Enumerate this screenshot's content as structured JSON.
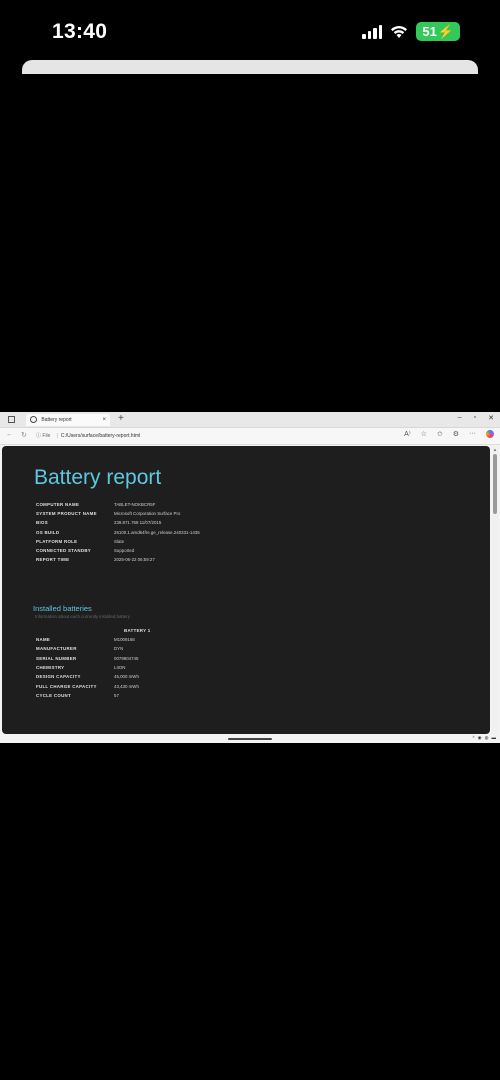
{
  "status_bar": {
    "time": "13:40",
    "battery_percent": "51",
    "battery_color": "#34c759"
  },
  "browser": {
    "tab_title": "Battery report",
    "tab_close": "×",
    "new_tab": "+",
    "window_controls": [
      "–",
      "▫",
      "✕"
    ],
    "url_info": "ⓘ File",
    "url_path": "C:/Users/surface/battery-report.html"
  },
  "report": {
    "title": "Battery report",
    "title_color": "#5ec8e0",
    "system_info": [
      {
        "key": "COMPUTER NAME",
        "value": "TABLET-NOKBCR5F"
      },
      {
        "key": "SYSTEM PRODUCT NAME",
        "value": "Microsoft Corporation Surface Pro"
      },
      {
        "key": "BIOS",
        "value": "239.871.768 11/07/2015"
      },
      {
        "key": "OS BUILD",
        "value": "26100.1.amd64fre.ge_release.240331-1435"
      },
      {
        "key": "PLATFORM ROLE",
        "value": "Slate"
      },
      {
        "key": "CONNECTED STANDBY",
        "value": "Supported"
      },
      {
        "key": "REPORT TIME",
        "value": "2025-06-22  06:59:27"
      }
    ],
    "installed_batteries": {
      "title": "Installed batteries",
      "subtitle": "Information about each currently installed battery",
      "column_header": "BATTERY 1",
      "rows": [
        {
          "key": "NAME",
          "value": "M1009168"
        },
        {
          "key": "MANUFACTURER",
          "value": "DYN"
        },
        {
          "key": "SERIAL NUMBER",
          "value": "0079904745"
        },
        {
          "key": "CHEMISTRY",
          "value": "LIION"
        },
        {
          "key": "DESIGN CAPACITY",
          "value": "45,000 mWh"
        },
        {
          "key": "FULL CHARGE CAPACITY",
          "value": "43,430 mWh"
        },
        {
          "key": "CYCLE COUNT",
          "value": "57"
        }
      ]
    }
  }
}
